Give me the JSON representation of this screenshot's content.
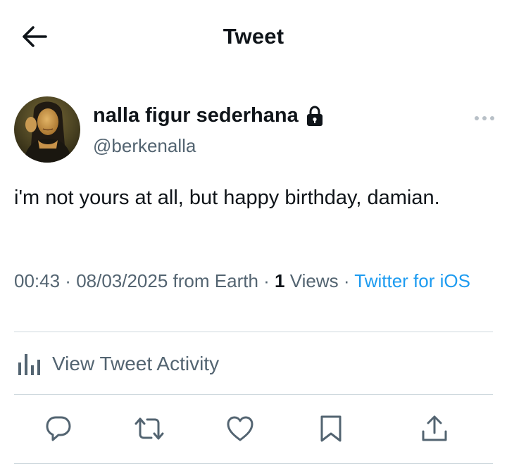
{
  "header": {
    "title": "Tweet",
    "back_icon": "arrow-left-icon"
  },
  "author": {
    "display_name": "nalla figur sederhana",
    "handle": "@berkenalla",
    "protected_icon": "lock-icon",
    "avatar": "avatar-image"
  },
  "tweet": {
    "text": "i'm not yours at all, but happy birthday, damian."
  },
  "meta": {
    "time": "00:43",
    "separator": " · ",
    "date": "08/03/2025",
    "location": " from Earth",
    "views_count": "1",
    "views_label": " Views",
    "source": "Twitter for iOS"
  },
  "activity": {
    "label": "View Tweet Activity",
    "icon": "bar-chart-icon"
  },
  "actions": [
    {
      "name": "reply",
      "icon": "reply-icon"
    },
    {
      "name": "retweet",
      "icon": "retweet-icon"
    },
    {
      "name": "like",
      "icon": "heart-icon"
    },
    {
      "name": "bookmark",
      "icon": "bookmark-icon"
    },
    {
      "name": "share",
      "icon": "share-icon"
    }
  ],
  "colors": {
    "text": "#0f1419",
    "secondary": "#536471",
    "link": "#1d9bf0",
    "divider": "#cfd9de"
  }
}
